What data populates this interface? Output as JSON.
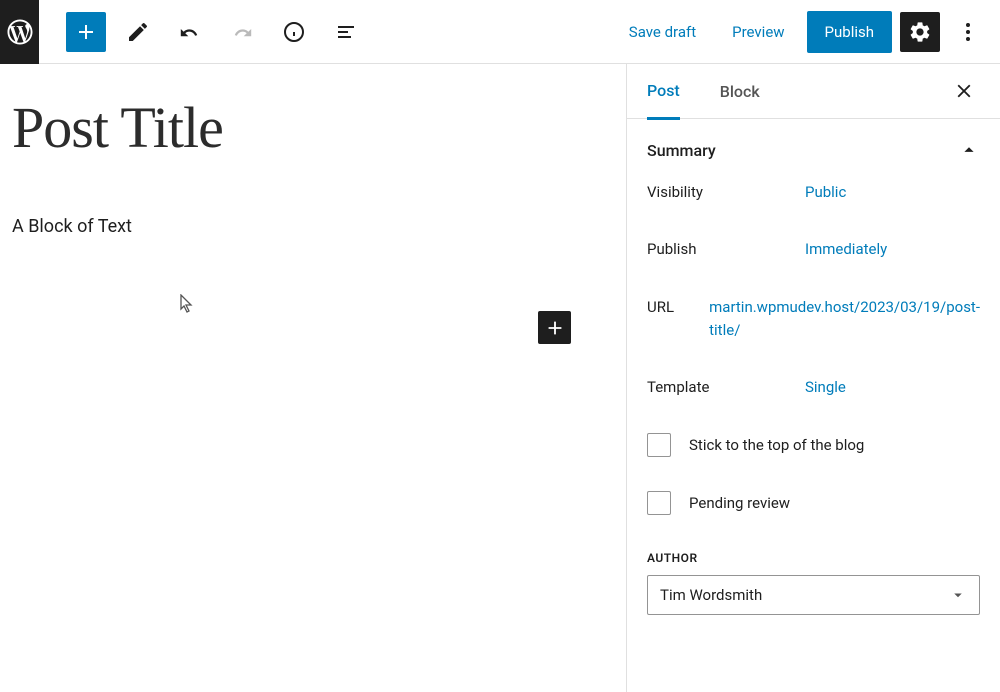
{
  "toolbar": {
    "save_draft": "Save draft",
    "preview": "Preview",
    "publish": "Publish"
  },
  "editor": {
    "title": "Post Title",
    "block_text": "A Block of Text"
  },
  "sidebar": {
    "tabs": {
      "post": "Post",
      "block": "Block"
    },
    "summary": {
      "title": "Summary",
      "visibility_label": "Visibility",
      "visibility_value": "Public",
      "publish_label": "Publish",
      "publish_value": "Immediately",
      "url_label": "URL",
      "url_value": "martin.wpmudev.host/2023/03/19/post-title/",
      "template_label": "Template",
      "template_value": "Single",
      "stick_label": "Stick to the top of the blog",
      "pending_label": "Pending review",
      "author_heading": "AUTHOR",
      "author_value": "Tim Wordsmith"
    }
  }
}
